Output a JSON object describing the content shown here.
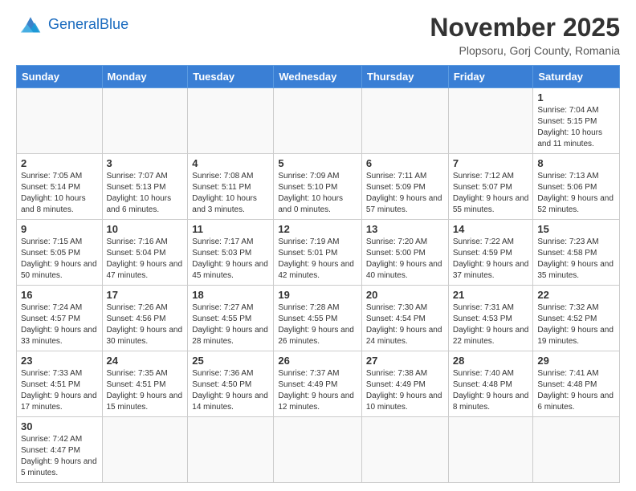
{
  "header": {
    "logo_general": "General",
    "logo_blue": "Blue",
    "month_title": "November 2025",
    "location": "Plopsoru, Gorj County, Romania"
  },
  "weekdays": [
    "Sunday",
    "Monday",
    "Tuesday",
    "Wednesday",
    "Thursday",
    "Friday",
    "Saturday"
  ],
  "weeks": [
    [
      {
        "day": "",
        "info": ""
      },
      {
        "day": "",
        "info": ""
      },
      {
        "day": "",
        "info": ""
      },
      {
        "day": "",
        "info": ""
      },
      {
        "day": "",
        "info": ""
      },
      {
        "day": "",
        "info": ""
      },
      {
        "day": "1",
        "info": "Sunrise: 7:04 AM\nSunset: 5:15 PM\nDaylight: 10 hours and 11 minutes."
      }
    ],
    [
      {
        "day": "2",
        "info": "Sunrise: 7:05 AM\nSunset: 5:14 PM\nDaylight: 10 hours and 8 minutes."
      },
      {
        "day": "3",
        "info": "Sunrise: 7:07 AM\nSunset: 5:13 PM\nDaylight: 10 hours and 6 minutes."
      },
      {
        "day": "4",
        "info": "Sunrise: 7:08 AM\nSunset: 5:11 PM\nDaylight: 10 hours and 3 minutes."
      },
      {
        "day": "5",
        "info": "Sunrise: 7:09 AM\nSunset: 5:10 PM\nDaylight: 10 hours and 0 minutes."
      },
      {
        "day": "6",
        "info": "Sunrise: 7:11 AM\nSunset: 5:09 PM\nDaylight: 9 hours and 57 minutes."
      },
      {
        "day": "7",
        "info": "Sunrise: 7:12 AM\nSunset: 5:07 PM\nDaylight: 9 hours and 55 minutes."
      },
      {
        "day": "8",
        "info": "Sunrise: 7:13 AM\nSunset: 5:06 PM\nDaylight: 9 hours and 52 minutes."
      }
    ],
    [
      {
        "day": "9",
        "info": "Sunrise: 7:15 AM\nSunset: 5:05 PM\nDaylight: 9 hours and 50 minutes."
      },
      {
        "day": "10",
        "info": "Sunrise: 7:16 AM\nSunset: 5:04 PM\nDaylight: 9 hours and 47 minutes."
      },
      {
        "day": "11",
        "info": "Sunrise: 7:17 AM\nSunset: 5:03 PM\nDaylight: 9 hours and 45 minutes."
      },
      {
        "day": "12",
        "info": "Sunrise: 7:19 AM\nSunset: 5:01 PM\nDaylight: 9 hours and 42 minutes."
      },
      {
        "day": "13",
        "info": "Sunrise: 7:20 AM\nSunset: 5:00 PM\nDaylight: 9 hours and 40 minutes."
      },
      {
        "day": "14",
        "info": "Sunrise: 7:22 AM\nSunset: 4:59 PM\nDaylight: 9 hours and 37 minutes."
      },
      {
        "day": "15",
        "info": "Sunrise: 7:23 AM\nSunset: 4:58 PM\nDaylight: 9 hours and 35 minutes."
      }
    ],
    [
      {
        "day": "16",
        "info": "Sunrise: 7:24 AM\nSunset: 4:57 PM\nDaylight: 9 hours and 33 minutes."
      },
      {
        "day": "17",
        "info": "Sunrise: 7:26 AM\nSunset: 4:56 PM\nDaylight: 9 hours and 30 minutes."
      },
      {
        "day": "18",
        "info": "Sunrise: 7:27 AM\nSunset: 4:55 PM\nDaylight: 9 hours and 28 minutes."
      },
      {
        "day": "19",
        "info": "Sunrise: 7:28 AM\nSunset: 4:55 PM\nDaylight: 9 hours and 26 minutes."
      },
      {
        "day": "20",
        "info": "Sunrise: 7:30 AM\nSunset: 4:54 PM\nDaylight: 9 hours and 24 minutes."
      },
      {
        "day": "21",
        "info": "Sunrise: 7:31 AM\nSunset: 4:53 PM\nDaylight: 9 hours and 22 minutes."
      },
      {
        "day": "22",
        "info": "Sunrise: 7:32 AM\nSunset: 4:52 PM\nDaylight: 9 hours and 19 minutes."
      }
    ],
    [
      {
        "day": "23",
        "info": "Sunrise: 7:33 AM\nSunset: 4:51 PM\nDaylight: 9 hours and 17 minutes."
      },
      {
        "day": "24",
        "info": "Sunrise: 7:35 AM\nSunset: 4:51 PM\nDaylight: 9 hours and 15 minutes."
      },
      {
        "day": "25",
        "info": "Sunrise: 7:36 AM\nSunset: 4:50 PM\nDaylight: 9 hours and 14 minutes."
      },
      {
        "day": "26",
        "info": "Sunrise: 7:37 AM\nSunset: 4:49 PM\nDaylight: 9 hours and 12 minutes."
      },
      {
        "day": "27",
        "info": "Sunrise: 7:38 AM\nSunset: 4:49 PM\nDaylight: 9 hours and 10 minutes."
      },
      {
        "day": "28",
        "info": "Sunrise: 7:40 AM\nSunset: 4:48 PM\nDaylight: 9 hours and 8 minutes."
      },
      {
        "day": "29",
        "info": "Sunrise: 7:41 AM\nSunset: 4:48 PM\nDaylight: 9 hours and 6 minutes."
      }
    ],
    [
      {
        "day": "30",
        "info": "Sunrise: 7:42 AM\nSunset: 4:47 PM\nDaylight: 9 hours and 5 minutes."
      },
      {
        "day": "",
        "info": ""
      },
      {
        "day": "",
        "info": ""
      },
      {
        "day": "",
        "info": ""
      },
      {
        "day": "",
        "info": ""
      },
      {
        "day": "",
        "info": ""
      },
      {
        "day": "",
        "info": ""
      }
    ]
  ]
}
